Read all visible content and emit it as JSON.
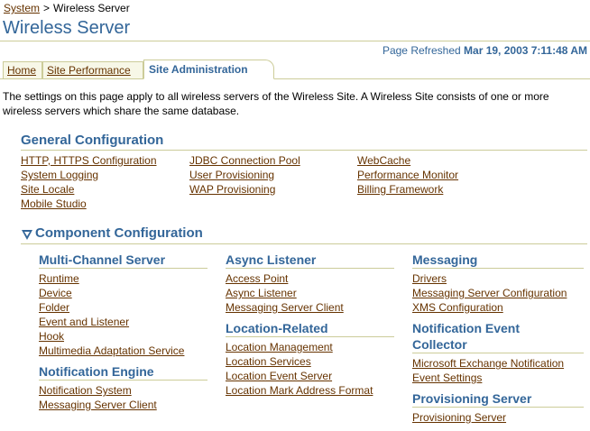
{
  "breadcrumb": {
    "root": "System",
    "separator": ">",
    "current": "Wireless Server"
  },
  "header": {
    "title": "Wireless Server",
    "refresh_label": "Page Refreshed",
    "refresh_time": "Mar 19, 2003 7:11:48 AM"
  },
  "tabs": [
    {
      "label": "Home"
    },
    {
      "label": "Site Performance"
    },
    {
      "label": "Site Administration"
    }
  ],
  "description": "The settings on this page apply to all wireless servers of the Wireless Site. A Wireless Site consists of one or more wireless servers which share the same database.",
  "general": {
    "title": "General Configuration",
    "col1": [
      "HTTP, HTTPS Configuration",
      "System Logging",
      "Site Locale",
      "Mobile Studio"
    ],
    "col2": [
      "JDBC Connection Pool",
      "User Provisioning",
      "WAP Provisioning"
    ],
    "col3": [
      "WebCache",
      "Performance Monitor",
      "Billing Framework"
    ]
  },
  "component": {
    "title": "Component Configuration",
    "multi_channel": {
      "title": "Multi-Channel Server",
      "links": [
        "Runtime",
        "Device",
        "Folder",
        "Event and Listener",
        "Hook",
        "Multimedia Adaptation Service"
      ]
    },
    "notification_engine": {
      "title": "Notification Engine",
      "links": [
        "Notification System",
        "Messaging Server Client"
      ]
    },
    "async_listener": {
      "title": "Async Listener",
      "links": [
        "Access Point",
        "Async Listener",
        "Messaging Server Client"
      ]
    },
    "location_related": {
      "title": "Location-Related",
      "links": [
        "Location Management",
        "Location Services",
        "Location Event Server",
        "Location Mark Address Format"
      ]
    },
    "messaging": {
      "title": "Messaging",
      "links": [
        "Drivers",
        "Messaging Server Configuration",
        "XMS Configuration"
      ]
    },
    "notification_event_collector": {
      "title_line1": "Notification Event",
      "title_line2": "Collector",
      "links": [
        "Microsoft Exchange Notification",
        "Event Settings"
      ]
    },
    "provisioning_server": {
      "title": "Provisioning Server",
      "links": [
        "Provisioning Server"
      ]
    }
  },
  "colors": {
    "accent": "#336699",
    "link": "#663300",
    "rule": "#cccc99",
    "tab_bg": "#f7f7e7"
  },
  "icons": {
    "collapse": "triangle-down-icon"
  }
}
